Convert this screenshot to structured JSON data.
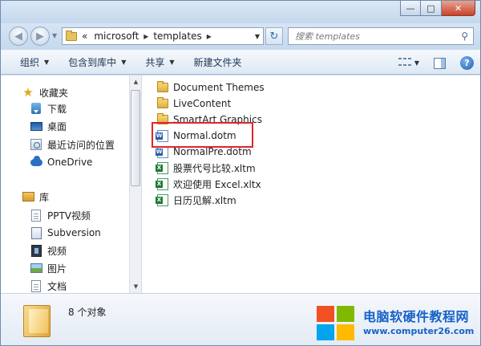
{
  "window": {
    "caption_min": "—",
    "caption_max": "□",
    "caption_close": "✕"
  },
  "address": {
    "overflow": "«",
    "crumbs": [
      "microsoft",
      "templates"
    ],
    "search_placeholder": "搜索 templates"
  },
  "toolbar": {
    "organize": "组织",
    "include_library": "包含到库中",
    "share": "共享",
    "new_folder": "新建文件夹"
  },
  "navigation": {
    "favorites_header": "收藏夹",
    "favorites": [
      {
        "label": "下载",
        "icon": "download-icon"
      },
      {
        "label": "桌面",
        "icon": "desktop-icon"
      },
      {
        "label": "最近访问的位置",
        "icon": "recent-places-icon"
      },
      {
        "label": "OneDrive",
        "icon": "onedrive-icon"
      }
    ],
    "libraries_header": "库",
    "libraries": [
      {
        "label": "PPTV视频",
        "icon": "document-icon"
      },
      {
        "label": "Subversion",
        "icon": "subversion-icon"
      },
      {
        "label": "视频",
        "icon": "video-icon"
      },
      {
        "label": "图片",
        "icon": "picture-icon"
      },
      {
        "label": "文档",
        "icon": "document-icon"
      }
    ]
  },
  "files": [
    {
      "name": "Document Themes",
      "type": "folder"
    },
    {
      "name": "LiveContent",
      "type": "folder"
    },
    {
      "name": "SmartArt Graphics",
      "type": "folder"
    },
    {
      "name": "Normal.dotm",
      "type": "word",
      "highlighted": true
    },
    {
      "name": "NormalPre.dotm",
      "type": "word"
    },
    {
      "name": "股票代号比较.xltm",
      "type": "excel"
    },
    {
      "name": "欢迎使用 Excel.xltx",
      "type": "excel"
    },
    {
      "name": "日历见解.xltm",
      "type": "excel"
    }
  ],
  "details": {
    "item_count": "8 个对象"
  },
  "watermark": {
    "title": "电脑软硬件教程网",
    "url": "www.computer26.com"
  },
  "colors": {
    "highlight_border": "#e0262b",
    "brand_blue": "#1662c7",
    "chrome_blue": "#c9dcef"
  }
}
